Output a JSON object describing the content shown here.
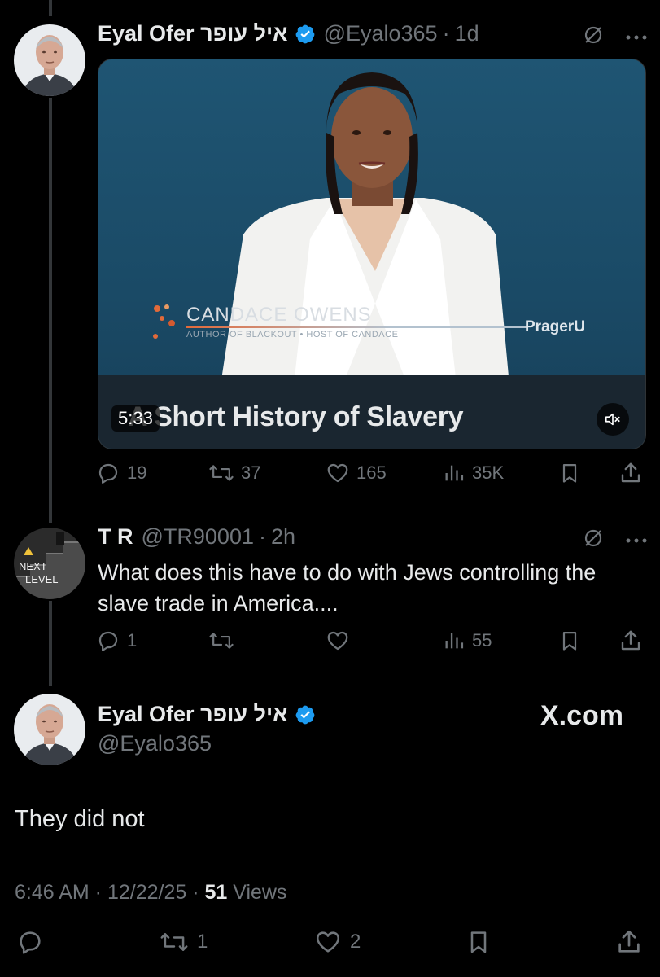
{
  "post1": {
    "name": "Eyal Ofer איל עופר",
    "handle": "@Eyalo365",
    "separator": "·",
    "time": "1d",
    "video": {
      "lower_third_name": "CANDACE OWENS",
      "lower_third_sub": "AUTHOR OF BLACKOUT • HOST OF CANDACE",
      "brand": "PragerU",
      "title": "A Short History of Slavery",
      "duration": "5:33"
    },
    "stats": {
      "replies": "19",
      "reposts": "37",
      "likes": "165",
      "views": "35K"
    }
  },
  "post2": {
    "name": "T R",
    "handle": "@TR90001",
    "separator": "·",
    "time": "2h",
    "avatar_text_top": "NEXT",
    "avatar_text_bottom": "LEVEL",
    "text": "What does this have to do with Jews controlling the slave trade in America....",
    "stats": {
      "replies": "1",
      "views": "55"
    }
  },
  "post3": {
    "name": "Eyal Ofer איל עופר",
    "handle": "@Eyalo365",
    "site_logo": "X.com",
    "text": "They did not",
    "timestamp": "6:46 AM · 12/22/25 · ",
    "views_count": "51",
    "views_label": " Views",
    "stats": {
      "reposts": "1",
      "likes": "2"
    }
  },
  "colors": {
    "background": "#000000",
    "text": "#e7e9ea",
    "muted": "#71767b",
    "verified": "#1d9bf0",
    "thread_line": "#333639"
  }
}
